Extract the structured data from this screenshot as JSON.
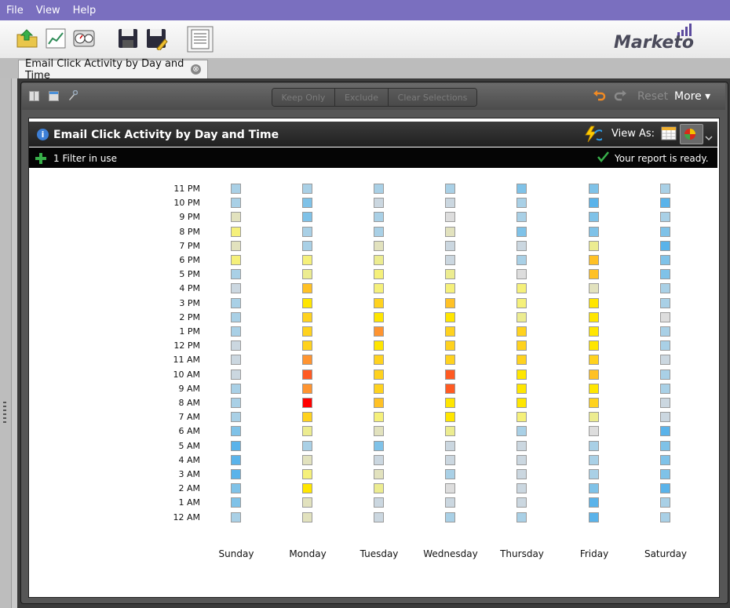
{
  "menu": {
    "file": "File",
    "view": "View",
    "help": "Help"
  },
  "brand": {
    "name": "Marketo"
  },
  "tab": {
    "label": "Email Click Activity by Day and Time",
    "close": "⊗"
  },
  "report_toolbar": {
    "keep_only": "Keep Only",
    "exclude": "Exclude",
    "clear_selections": "Clear Selections",
    "reset": "Reset",
    "more": "More ▾"
  },
  "report": {
    "title": "Email Click Activity by Day and Time",
    "info_icon": "i",
    "view_as": "View As:",
    "filter_text": "1 Filter in use",
    "status": "Your report is ready."
  },
  "heatmap": {
    "hours": [
      "11 PM",
      "10 PM",
      "9 PM",
      "8 PM",
      "7 PM",
      "6 PM",
      "5 PM",
      "4 PM",
      "3 PM",
      "2 PM",
      "1 PM",
      "12 PM",
      "11 AM",
      "10 AM",
      "9 AM",
      "8 AM",
      "7 AM",
      "6 AM",
      "5 AM",
      "4 AM",
      "3 AM",
      "2 AM",
      "1 AM",
      "12 AM"
    ],
    "days": [
      "Sunday",
      "Monday",
      "Tuesday",
      "Wednesday",
      "Thursday",
      "Friday",
      "Saturday"
    ],
    "palette": {
      "a": "#a9d0e6",
      "b": "#7fc2e8",
      "c": "#cbd7e0",
      "d": "#e2e2be",
      "e": "#f5f07a",
      "f": "#ecec90",
      "g": "#ffe600",
      "h": "#ffd21e",
      "i": "#ffc125",
      "j": "#ff9430",
      "k": "#ff5a22",
      "l": "#ff0000",
      "m": "#5ab3ea",
      "n": "#dddddd"
    },
    "rows": [
      [
        "a",
        "a",
        "a",
        "a",
        "b",
        "b",
        "a"
      ],
      [
        "a",
        "b",
        "c",
        "c",
        "a",
        "m",
        "m"
      ],
      [
        "d",
        "b",
        "a",
        "n",
        "a",
        "b",
        "a"
      ],
      [
        "e",
        "a",
        "a",
        "d",
        "b",
        "b",
        "b"
      ],
      [
        "d",
        "a",
        "d",
        "c",
        "c",
        "f",
        "m"
      ],
      [
        "e",
        "e",
        "f",
        "c",
        "a",
        "i",
        "b"
      ],
      [
        "a",
        "f",
        "e",
        "f",
        "n",
        "i",
        "b"
      ],
      [
        "c",
        "i",
        "e",
        "e",
        "e",
        "d",
        "a"
      ],
      [
        "a",
        "g",
        "h",
        "i",
        "e",
        "g",
        "a"
      ],
      [
        "a",
        "h",
        "g",
        "g",
        "f",
        "g",
        "n"
      ],
      [
        "a",
        "h",
        "j",
        "h",
        "h",
        "g",
        "a"
      ],
      [
        "c",
        "h",
        "g",
        "h",
        "h",
        "g",
        "a"
      ],
      [
        "c",
        "j",
        "h",
        "h",
        "h",
        "h",
        "c"
      ],
      [
        "c",
        "k",
        "h",
        "k",
        "g",
        "i",
        "a"
      ],
      [
        "a",
        "j",
        "h",
        "k",
        "g",
        "g",
        "a"
      ],
      [
        "a",
        "l",
        "i",
        "g",
        "g",
        "h",
        "c"
      ],
      [
        "a",
        "h",
        "e",
        "g",
        "e",
        "f",
        "c"
      ],
      [
        "b",
        "f",
        "d",
        "f",
        "a",
        "n",
        "m"
      ],
      [
        "m",
        "a",
        "b",
        "c",
        "c",
        "a",
        "b"
      ],
      [
        "m",
        "d",
        "c",
        "c",
        "c",
        "a",
        "b"
      ],
      [
        "m",
        "e",
        "d",
        "a",
        "c",
        "a",
        "b"
      ],
      [
        "b",
        "g",
        "f",
        "n",
        "c",
        "b",
        "m"
      ],
      [
        "b",
        "d",
        "c",
        "c",
        "c",
        "m",
        "a"
      ],
      [
        "a",
        "d",
        "c",
        "a",
        "a",
        "m",
        "a"
      ]
    ]
  }
}
